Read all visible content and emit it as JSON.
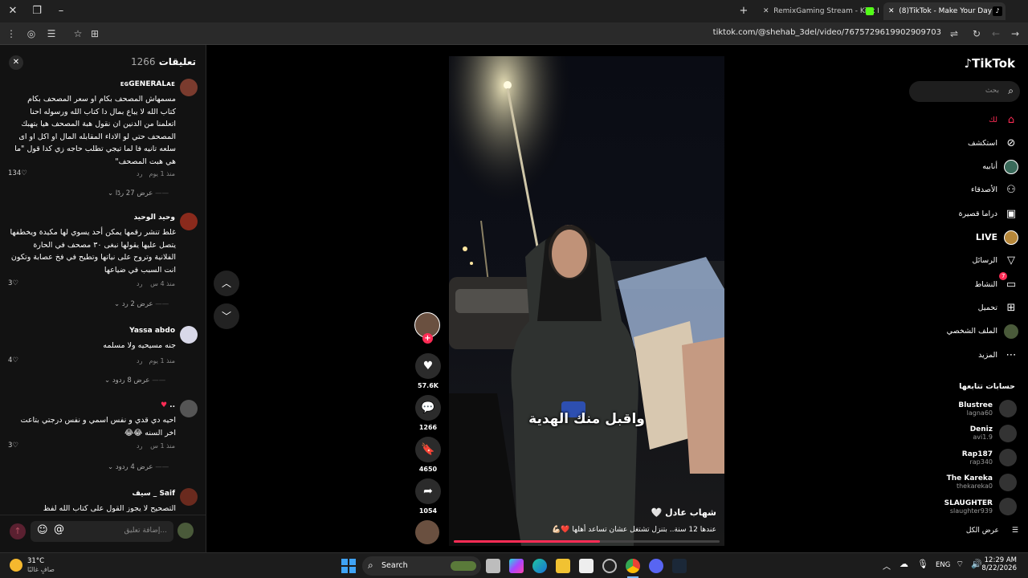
{
  "browser": {
    "tabs": [
      {
        "label": "RemixGaming Stream - Kick De"
      },
      {
        "label": "(8)TikTok - Make Your Day"
      }
    ],
    "url": "tiktok.com/@shehab_3del/video/7675729619902909703",
    "new_tab_symbol": "+"
  },
  "comments": {
    "title": "تعليقات",
    "count": "1266",
    "close_symbol": "✕",
    "items": [
      {
        "name": "ᴇɢGENERALᴀᴇ",
        "text": "مسمهاش المصحف بكام او سعر المصحف بكام كتاب الله لا يباع بمال دا كتاب الله ورسوله احنا اتعلمنا من الدنين ان نقول هبة المصحف هيا بتهبك المصحف حتي لو الاداء المقابله المال او اكل او اى سلعه تانيه فا لما تيجي تطلب حاجه زي كدا قول \"ما هي هبت المصحف\"",
        "time": "منذ 1 يوم",
        "reply": "رد",
        "likes": "134",
        "replies": "عرض 27 ردًا"
      },
      {
        "name": "وحيد الوحيد",
        "text": "غلط تنشر رقمها يمكن أحد يسوي لها مكيدة ويخطفها يتصل عليها يقولها نبغى ٣٠ مصحف في الحارة الفلانية وتروح على نياتها وتطيح في فخ عصابة وتكون انت السبب في ضياعها",
        "time": "منذ 4 س",
        "reply": "رد",
        "likes": "3",
        "replies": "عرض 2 رد"
      },
      {
        "name": "Yassa abdo",
        "text": "جنه مسيحيه ولا مسلمه",
        "time": "منذ 1 يوم",
        "reply": "رد",
        "likes": "4",
        "replies": "عرض 8 ردود"
      },
      {
        "name": "..",
        "text": "احيه دي قدي و نفس اسمي و نفس درجتي بتاعت اخر السنه 😂😂",
        "time": "منذ 1 س",
        "reply": "رد",
        "likes": "3",
        "replies": "عرض 4 ردود"
      },
      {
        "name": "سيف _ Saif",
        "text": "التصحيح لا يجوز القول على كتاب الله لفظ",
        "time": "",
        "reply": "",
        "likes": "",
        "replies": ""
      }
    ],
    "input_placeholder": "إضافة تعليق..."
  },
  "video": {
    "caption_overlay": "واقبل منك الهدية",
    "author": "شهاب عادل 🤍",
    "description": "عندها 12 سنة.. بتنزل تشتغل عشان تساعد أهلها ❤️💪🏻",
    "progress": 0.55,
    "likes": "57.6K",
    "comments": "1266",
    "saves": "4650",
    "shares": "1054"
  },
  "sidebar": {
    "brand": "TikTok",
    "search_placeholder": "بحث",
    "nav": [
      {
        "label": "لك",
        "icon": "home-icon",
        "active": true
      },
      {
        "label": "استكشف",
        "icon": "compass-icon"
      },
      {
        "label": "أنابيه",
        "icon": "avatar-icon"
      },
      {
        "label": "الأصدقاء",
        "icon": "friends-icon"
      },
      {
        "label": "دراما قصيرة",
        "icon": "film-icon"
      },
      {
        "label": "LIVE",
        "icon": "live-icon"
      },
      {
        "label": "الرسائل",
        "icon": "send-icon"
      },
      {
        "label": "النشاط",
        "icon": "activity-icon",
        "badge": "7"
      },
      {
        "label": "تحميل",
        "icon": "upload-icon"
      },
      {
        "label": "الملف الشخصي",
        "icon": "profile-icon"
      },
      {
        "label": "المزيد",
        "icon": "more-icon"
      }
    ],
    "following_title": "حسابات تتابعها",
    "following": [
      {
        "name": "Blustree",
        "handle": "lagna60"
      },
      {
        "name": "Deniz",
        "handle": "avi1.9"
      },
      {
        "name": "Rap187",
        "handle": "rap340"
      },
      {
        "name": "The Kareka",
        "handle": "thekareka0"
      },
      {
        "name": "SLAUGHTER",
        "handle": "slaughter939"
      }
    ],
    "see_all": "عرض الكل"
  },
  "taskbar": {
    "weather_temp": "31°C",
    "weather_desc": "صافٍ غالبًا",
    "search_label": "Search",
    "lang": "ENG",
    "time": "12:29 AM",
    "date": "8/22/2026"
  },
  "colors": {
    "accent": "#fe2c55",
    "panel": "#121212"
  }
}
